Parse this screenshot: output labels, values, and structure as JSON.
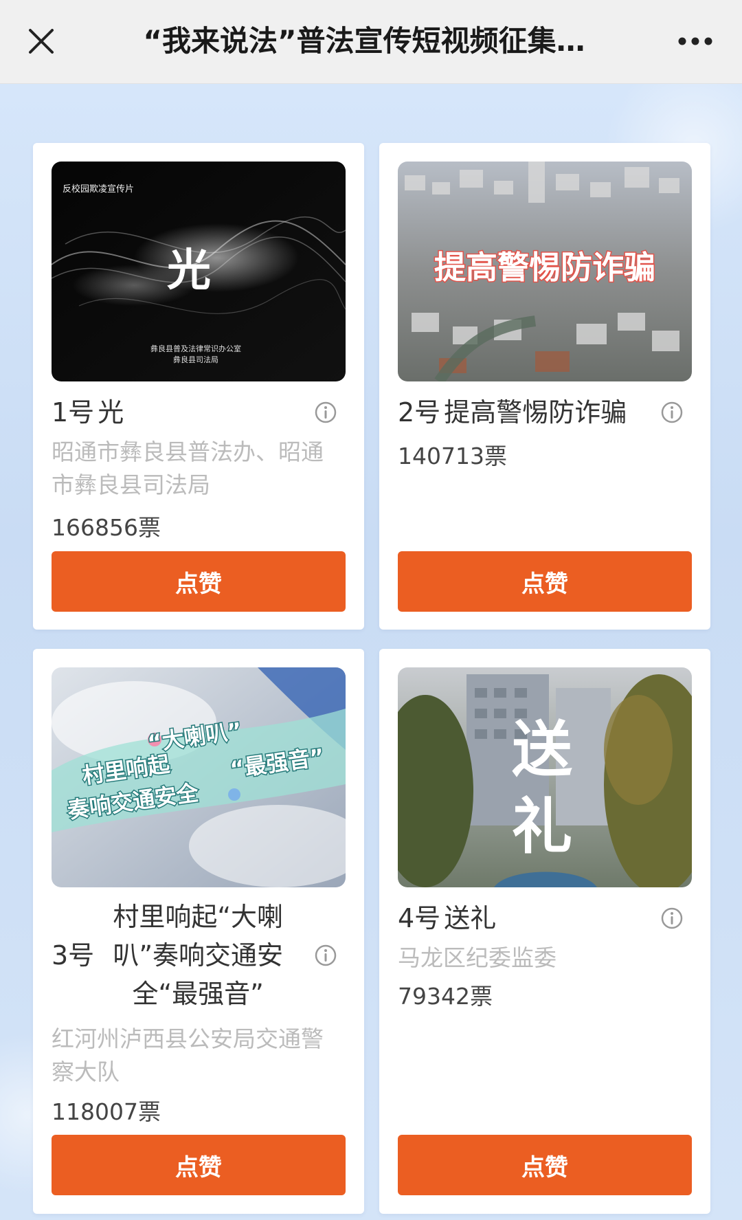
{
  "header": {
    "title": "“我来说法”普法宣传短视频征集…"
  },
  "cards": [
    {
      "number": "1号",
      "title": "光",
      "thumb_caption_top": "反校园欺凌宣传片",
      "thumb_main": "光",
      "thumb_caption_bottom_1": "彝良县普及法律常识办公室",
      "thumb_caption_bottom_2": "彝良县司法局",
      "org": "昭通市彝良县普法办、昭通市彝良县司法局",
      "votes": "166856票",
      "like_label": "点赞"
    },
    {
      "number": "2号",
      "title": "提高警惕防诈骗",
      "thumb_main": "提高警惕防诈骗",
      "org": "",
      "votes": "140713票",
      "like_label": "点赞"
    },
    {
      "number": "3号",
      "title_lines": [
        "村里响起“大喇",
        "叭”奏响交通安",
        "全“最强音”"
      ],
      "thumb_line_1a": "村里响起",
      "thumb_line_1b": "“大喇叭”",
      "thumb_line_2a": "奏响交通安全",
      "thumb_line_2b": "“最强音”",
      "org": "红河州泸西县公安局交通警察大队",
      "votes": "118007票",
      "like_label": "点赞"
    },
    {
      "number": "4号",
      "title": "送礼",
      "thumb_main_1": "送",
      "thumb_main_2": "礼",
      "org": "马龙区纪委监委",
      "votes": "79342票",
      "like_label": "点赞"
    }
  ],
  "colors": {
    "accent": "#eb5e22",
    "background": "#d6e6fa"
  }
}
